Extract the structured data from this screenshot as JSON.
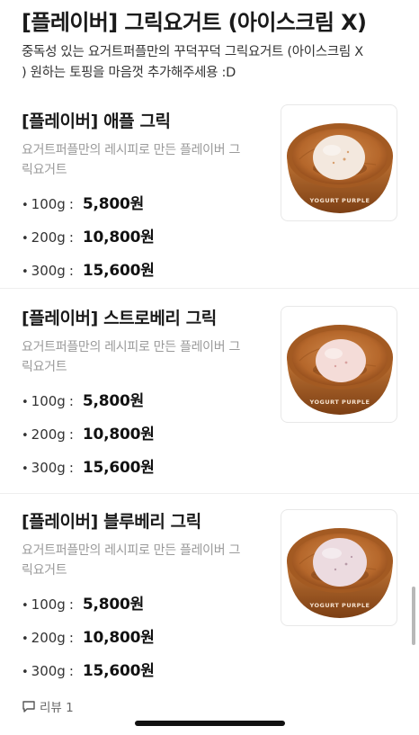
{
  "category": {
    "title": "[플레이버] 그릭요거트 (아이스크림 X)",
    "description_line1": "중독성 있는 요거트퍼플만의 꾸덕꾸덕 그릭요거트 (아이스크림 X",
    "description_line2": ") 원하는 토핑을 마음껏 추가해주세용 :D"
  },
  "items": [
    {
      "name": "[플레이버] 애플 그릭",
      "description_line1": "요거트퍼플만의 레시피로 만든 플레이버 그",
      "description_line2": "릭요거트",
      "prices": [
        {
          "size": "100g",
          "price": "5,800원"
        },
        {
          "size": "200g",
          "price": "10,800원"
        },
        {
          "size": "300g",
          "price": "15,600원"
        }
      ],
      "bowl_text": "YOGURT PURPLE",
      "scoop_color": "#f3e8de"
    },
    {
      "name": "[플레이버] 스트로베리 그릭",
      "description_line1": "요거트퍼플만의 레시피로 만든 플레이버 그",
      "description_line2": "릭요거트",
      "prices": [
        {
          "size": "100g",
          "price": "5,800원"
        },
        {
          "size": "200g",
          "price": "10,800원"
        },
        {
          "size": "300g",
          "price": "15,600원"
        }
      ],
      "bowl_text": "YOGURT PURPLE",
      "scoop_color": "#f4dcd8"
    },
    {
      "name": "[플레이버] 블루베리 그릭",
      "description_line1": "요거트퍼플만의 레시피로 만든 플레이버 그",
      "description_line2": "릭요거트",
      "prices": [
        {
          "size": "100g",
          "price": "5,800원"
        },
        {
          "size": "200g",
          "price": "10,800원"
        },
        {
          "size": "300g",
          "price": "15,600원"
        }
      ],
      "bowl_text": "YOGURT PURPLE",
      "scoop_color": "#ecdbe0"
    }
  ],
  "review": {
    "icon": "speech-bubble-icon",
    "label": "리뷰 1"
  },
  "colors": {
    "bowl_wood": "#b86a2e",
    "bowl_wood_dark": "#7c3f14",
    "description_gray": "#9a9a9a"
  }
}
